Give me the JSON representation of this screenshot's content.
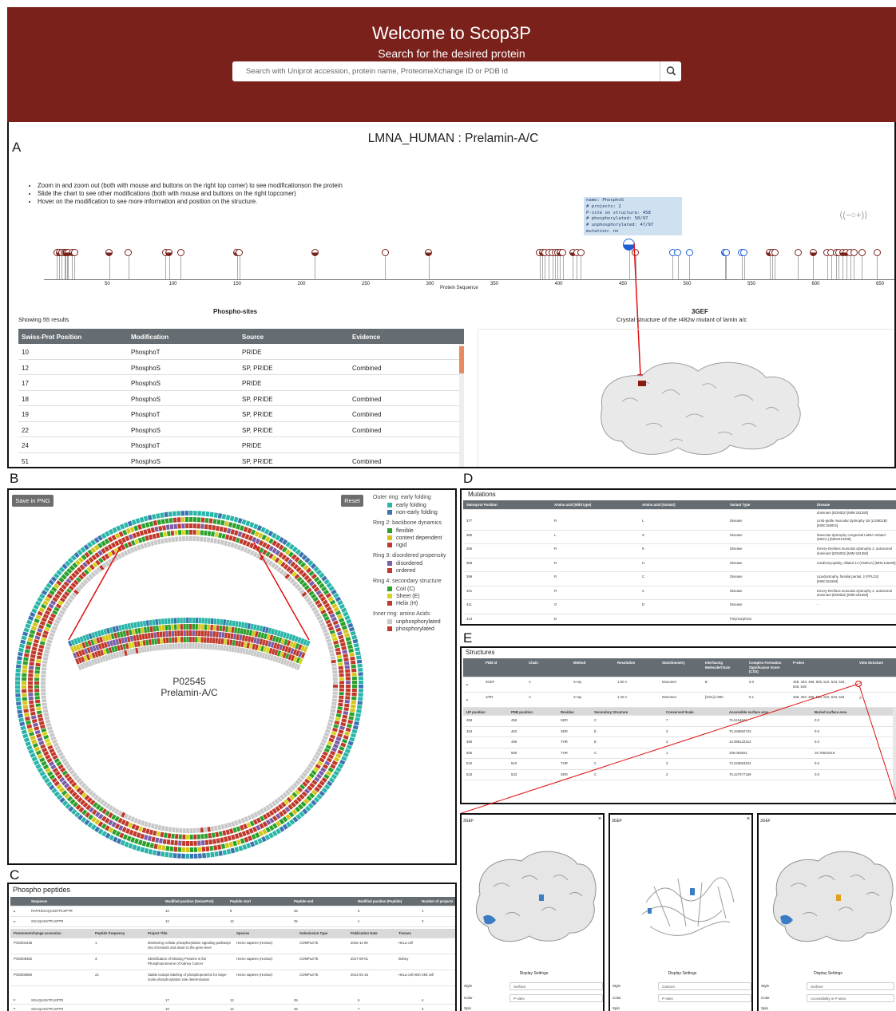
{
  "header": {
    "title": "Welcome to Scop3P",
    "subtitle": "Search for the desired protein",
    "search_placeholder": "Search with Uniprot accession, protein name, ProteomeXchange ID or PDB id"
  },
  "panel_labels": {
    "a": "A",
    "b": "B",
    "c": "C",
    "d": "D",
    "e": "E"
  },
  "colors": {
    "brand": "#7a211b",
    "table_header": "#666d72",
    "phospho": "#7a211b",
    "structure_site": "#1f5fd6"
  },
  "panelA": {
    "protein_title": "LMNA_HUMAN : Prelamin-A/C",
    "instructions": [
      "Zoom in and zoom out (both with mouse and buttons on the right top corner) to see modificationson the protein",
      "Slide the chart to see other modifications (both with mouse and buttons on the right topcomer)",
      "Hover on the modification to see more information and position on the structure."
    ],
    "tooltip": [
      "name: PhosphoS",
      "# projects: 2",
      "P-site on structure: 458",
      "# phosphorylated: 50/97",
      "# unphosphorylated: 47/97",
      "mutation: no"
    ],
    "zoom_controls": "⟨(−○+)⟩",
    "axis_label": "Protein Sequence",
    "axis_ticks": [
      "50",
      "100",
      "150",
      "200",
      "250",
      "300",
      "350",
      "400",
      "450",
      "500",
      "550",
      "600",
      "650"
    ],
    "sites_title": "Phospho-sites",
    "results_text": "Showing 55 results",
    "structure_id": "3GEF",
    "structure_title": "Crystal structure of the r482w mutant of lamin a/c",
    "table_headers": [
      "Swiss-Prot Position",
      "Modification",
      "Source",
      "Evidence"
    ],
    "table_rows": [
      [
        "10",
        "PhosphoT",
        "PRIDE",
        ""
      ],
      [
        "12",
        "PhosphoS",
        "SP, PRIDE",
        "Combined"
      ],
      [
        "17",
        "PhosphoS",
        "PRIDE",
        ""
      ],
      [
        "18",
        "PhosphoS",
        "SP, PRIDE",
        "Combined"
      ],
      [
        "19",
        "PhosphoT",
        "SP, PRIDE",
        "Combined"
      ],
      [
        "22",
        "PhosphoS",
        "SP, PRIDE",
        "Combined"
      ],
      [
        "24",
        "PhosphoT",
        "PRIDE",
        ""
      ],
      [
        "51",
        "PhosphoS",
        "SP, PRIDE",
        "Combined"
      ]
    ]
  },
  "panelB": {
    "save_button": "Save in PNG",
    "reset_button": "Reset",
    "accession": "P02545",
    "protein_name": "Prelamin-A/C",
    "legend": [
      {
        "title": "Outer ring: early folding",
        "items": [
          {
            "label": "early folding",
            "color": "#29b5a8"
          },
          {
            "label": "non-early folding",
            "color": "#3a73b0"
          }
        ]
      },
      {
        "title": "Ring 2: backbone dynamics",
        "items": [
          {
            "label": "flexible",
            "color": "#2ca02c"
          },
          {
            "label": "context dependent",
            "color": "#d4c41a"
          },
          {
            "label": "rigid",
            "color": "#c0392b"
          }
        ]
      },
      {
        "title": "Ring 3: disordered propensity",
        "items": [
          {
            "label": "disordered",
            "color": "#7b5ea7"
          },
          {
            "label": "ordered",
            "color": "#c0392b"
          }
        ]
      },
      {
        "title": "Ring 4: secondary structure",
        "items": [
          {
            "label": "Coil (C)",
            "color": "#2ca02c"
          },
          {
            "label": "Sheet (E)",
            "color": "#d4d41a"
          },
          {
            "label": "Helix (H)",
            "color": "#c0392b"
          }
        ]
      },
      {
        "title": "Inner ring: amino Acids",
        "items": [
          {
            "label": "unphosphorylated",
            "color": "#c8c8c8"
          },
          {
            "label": "phosphorylated",
            "color": "#c0392b"
          }
        ]
      }
    ]
  },
  "panelC": {
    "title": "Phospho peptides",
    "headers": [
      "Sequence",
      "Modified position (SwissProt)",
      "Peptide start",
      "Peptide end",
      "Modified position (Peptide)",
      "Number of projects"
    ],
    "rows": [
      [
        "RATRSGAQASSTPLSPTR",
        "12",
        "8",
        "25",
        "5",
        "1"
      ],
      [
        "SGAQASSTPLSPTR",
        "12",
        "12",
        "25",
        "1",
        "3"
      ]
    ],
    "sub_headers": [
      "ProteomeXchange accession",
      "Peptide frequency",
      "Project Title",
      "Species",
      "Submission Type",
      "Publication Date",
      "Tissues"
    ],
    "sub_rows": [
      [
        "PXD002436",
        "1",
        "Monitoring cellular phosphorylation signaling pathways into chromatin and down to the gene level",
        "Homo sapiens (Human)",
        "COMPLETE",
        "2016-11-09",
        "HeLa cell"
      ],
      [
        "PXD006482",
        "3",
        "Identification of Missing Proteins in the Phosphoproteome of Kidney Cancer",
        "Homo sapiens (Human)",
        "COMPLETE",
        "2017-09-01",
        "kidney"
      ],
      [
        "PXD000680",
        "21",
        "Stable isotope labeling of phosphoproteins for large-scale phosphorylation rate determination",
        "Homo sapiens (Human)",
        "COMPLETE",
        "2014-04-15",
        "HeLa cell,HEK-293 cell"
      ]
    ],
    "rows_after": [
      [
        "SGAQASSTPLSPTR",
        "17",
        "12",
        "25",
        "6",
        "4"
      ],
      [
        "SGAQASSTPLSPTR",
        "18",
        "12",
        "25",
        "7",
        "3"
      ]
    ]
  },
  "panelD": {
    "title": "Mutations",
    "headers": [
      "Swissprot Position",
      "Amino acid (Wild type)",
      "Amino acid (Variant)",
      "Variant Type",
      "Disease"
    ],
    "top_partial": "dominant (EDMD2) [MIM:181350]",
    "rows": [
      [
        "377",
        "R",
        "L",
        "Disease",
        "Limb-girdle muscular dystrophy 1B (LGMD1B) [MIM:159001]"
      ],
      [
        "380",
        "L",
        "S",
        "Disease",
        "Muscular dystrophy congenital LMNA-related (MDCL) [MIM:613205]"
      ],
      [
        "386",
        "R",
        "K",
        "Disease",
        "Emery-Dreifuss muscular dystrophy 2, autosomal dominant (EDMD2) [MIM:181350]"
      ],
      [
        "388",
        "R",
        "H",
        "Disease",
        "Cardiomyopathy, dilated 1A (CMD1A) [MIM:115200]"
      ],
      [
        "399",
        "R",
        "C",
        "Disease",
        "Lipodystrophy, familial partial, 2 (FPLD2) [MIM:151660]"
      ],
      [
        "401",
        "R",
        "C",
        "Disease",
        "Emery-Dreifuss muscular dystrophy 2, autosomal dominant (EDMD2) [MIM:181350]"
      ],
      [
        "411",
        "G",
        "D",
        "Disease",
        "-"
      ],
      [
        "413",
        "D",
        "",
        "Polymorphism",
        ""
      ]
    ]
  },
  "panelE": {
    "title": "Structures",
    "headers": [
      "PDB id",
      "Chain",
      "Method",
      "Resolution",
      "Stoichiometry",
      "Interfacing Molecule/Chain",
      "Complex Formation Significance Score (CSS)",
      "P-sites",
      "View Structure"
    ],
    "rows": [
      [
        "3GEF",
        "A",
        "X-ray",
        "1.50 A",
        "Monomer",
        "B",
        "0.0",
        "458, 463, 496, 505, 510, 533, 534, 546, 548"
      ],
      [
        "1IFR",
        "A",
        "X-ray",
        "1.40 A",
        "Monomer",
        "[GOL]A:600",
        "0.1",
        "458, 463, 496, 505, 510, 533, 534"
      ]
    ],
    "sub_headers": [
      "UP position",
      "PDB position",
      "Residue",
      "Secondary Structure",
      "Conserved Scale",
      "Accessible surface area",
      "Buried surface area"
    ],
    "sub_rows": [
      [
        "458",
        "458",
        "SER",
        "C",
        "7",
        "75.6154641",
        "0.0"
      ],
      [
        "463",
        "463",
        "SER",
        "E",
        "3",
        "75.346062723",
        "0.0"
      ],
      [
        "496",
        "496",
        "THR",
        "E",
        "3",
        "13.085122312",
        "0.0"
      ],
      [
        "505",
        "505",
        "THR",
        "C",
        "1",
        "109.063624",
        "15.76504218"
      ],
      [
        "510",
        "510",
        "THR",
        "C",
        "3",
        "74.226063324",
        "0.0"
      ],
      [
        "533",
        "533",
        "SER",
        "C",
        "2",
        "76.427677169",
        "0.0"
      ]
    ]
  },
  "viewers": [
    {
      "id": "3GEF",
      "settings_title": "Display Settings",
      "style_label": "Style",
      "style_value": "Surface",
      "color_label": "Color",
      "color_value": "P-sites",
      "spin_label": "Spin"
    },
    {
      "id": "3GEF",
      "settings_title": "Display Settings",
      "style_label": "Style",
      "style_value": "Cartoon",
      "color_label": "Color",
      "color_value": "P-sites",
      "spin_label": "Spin"
    },
    {
      "id": "3GEF",
      "settings_title": "Display Settings",
      "style_label": "Style",
      "style_value": "Surface",
      "color_label": "Color",
      "color_value": "Accessibility in P-sites",
      "spin_label": "Spin"
    }
  ]
}
